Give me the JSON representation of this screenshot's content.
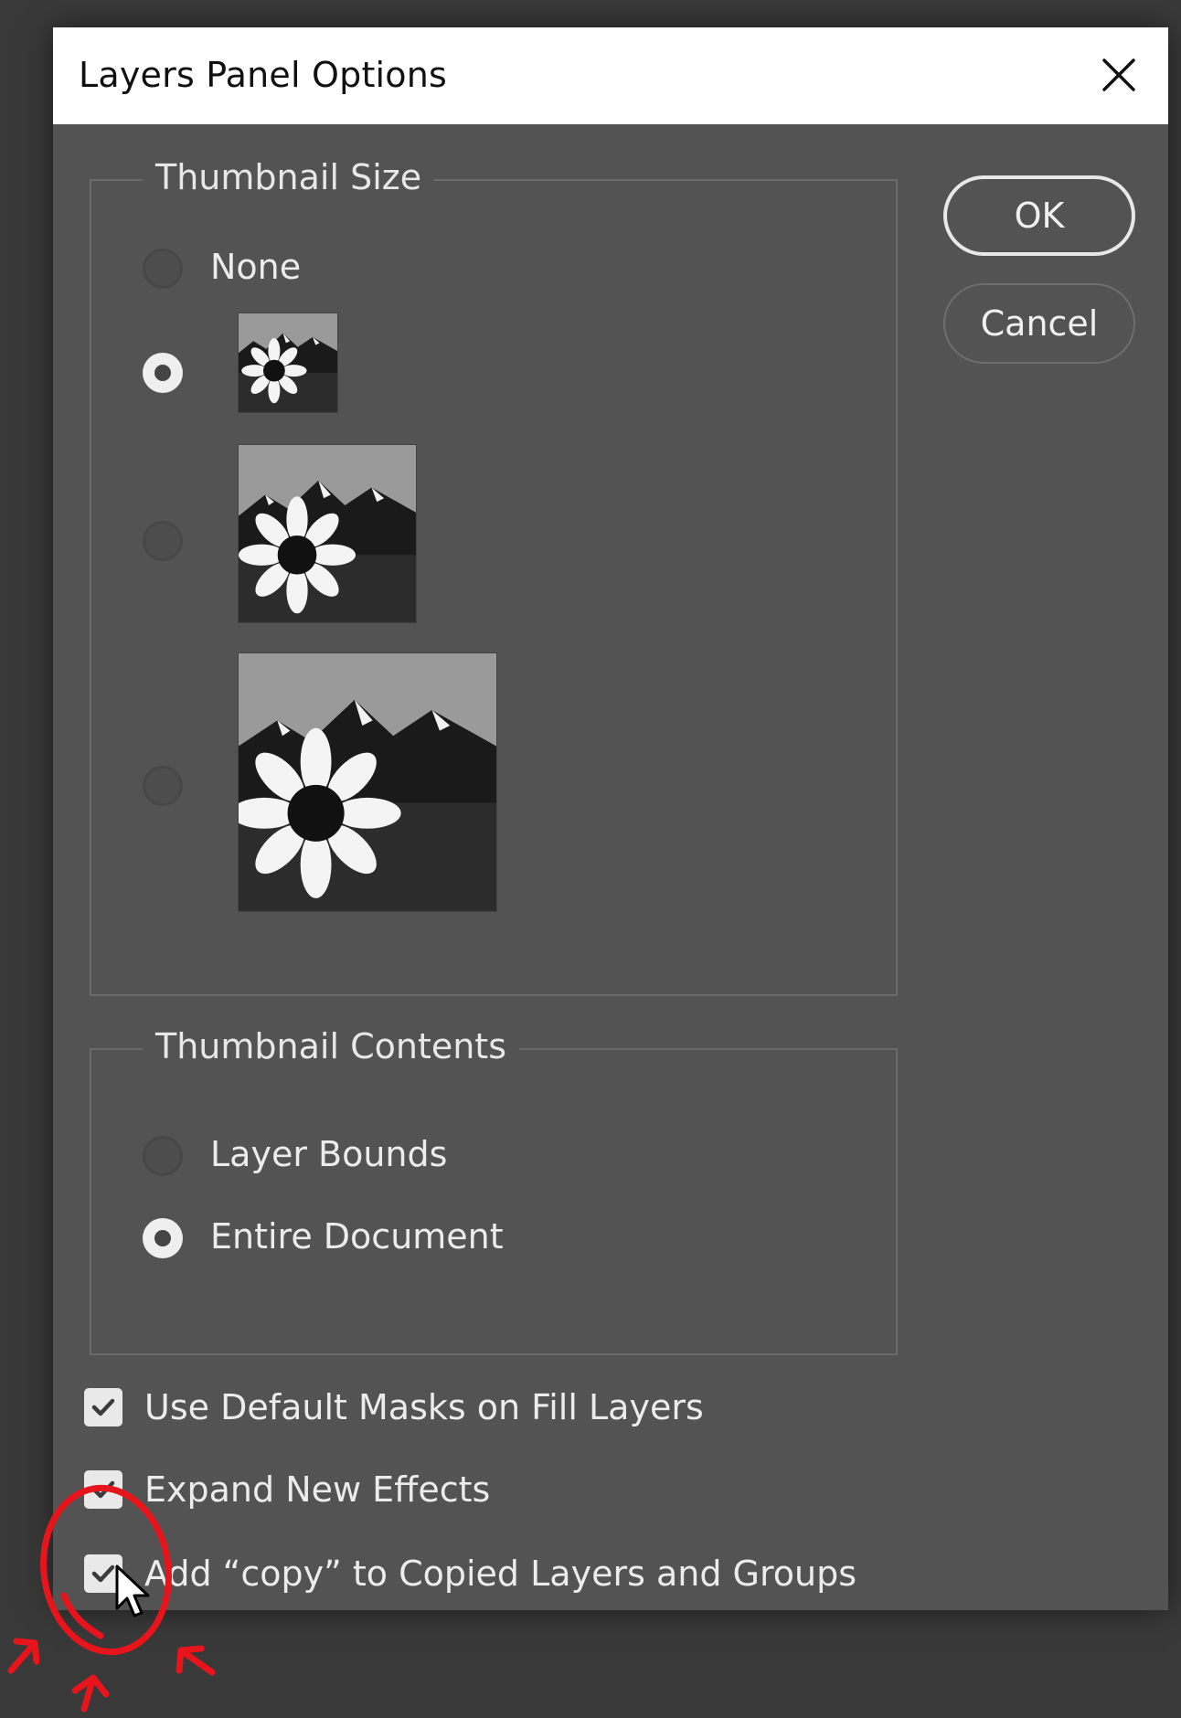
{
  "dialog": {
    "title": "Layers Panel Options",
    "close_icon": "close-x-icon"
  },
  "buttons": {
    "ok": "OK",
    "cancel": "Cancel"
  },
  "thumbnail_size": {
    "label": "Thumbnail Size",
    "options": [
      {
        "label": "None",
        "selected": false
      },
      {
        "label": "",
        "selected": true,
        "size": "small"
      },
      {
        "label": "",
        "selected": false,
        "size": "medium"
      },
      {
        "label": "",
        "selected": false,
        "size": "large"
      }
    ]
  },
  "thumbnail_contents": {
    "label": "Thumbnail Contents",
    "options": [
      {
        "label": "Layer Bounds",
        "selected": false
      },
      {
        "label": "Entire Document",
        "selected": true
      }
    ]
  },
  "checkboxes": [
    {
      "label": "Use Default Masks on Fill Layers",
      "checked": true
    },
    {
      "label": "Expand New Effects",
      "checked": true
    },
    {
      "label": "Add “copy” to Copied Layers and Groups",
      "checked": true
    }
  ],
  "annotation": {
    "color": "#e8141c",
    "shape": "circle-with-arrows"
  },
  "colors": {
    "dialog_bg": "#535353",
    "page_bg": "#393939",
    "titlebar_bg": "#ffffff"
  }
}
